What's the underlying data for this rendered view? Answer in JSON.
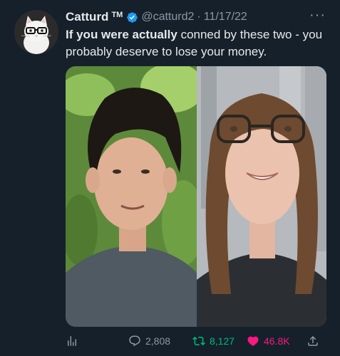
{
  "tweet": {
    "author_name": "Catturd",
    "author_suffix": "TM",
    "handle": "@catturd2",
    "separator": "·",
    "date": "11/17/22",
    "text_bold": "If you were actually",
    "text_rest": " conned by these two - you probably deserve to lose your money."
  },
  "actions": {
    "replies": "2,808",
    "retweets": "8,127",
    "likes": "46.8K"
  },
  "colors": {
    "background": "#15202b",
    "secondary_text": "#8b98a5",
    "verified": "#1d9bf0",
    "retweet": "#00ba7c",
    "like": "#f91880"
  },
  "icons": {
    "more": "more-dots-icon",
    "views": "analytics-icon",
    "reply": "reply-bubble-icon",
    "retweet": "retweet-icon",
    "like": "heart-icon",
    "share": "share-icon",
    "verified": "verified-badge-icon"
  }
}
